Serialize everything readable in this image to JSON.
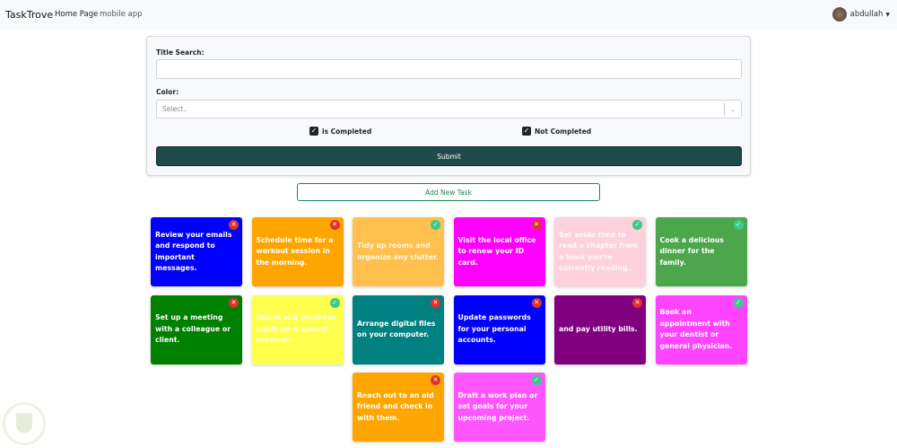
{
  "nav": {
    "brand": "TaskTrove",
    "links": [
      "Home Page",
      "mobile app"
    ],
    "user": "abdullah"
  },
  "form": {
    "title_label": "Title Search:",
    "title_value": "",
    "color_label": "Color:",
    "color_placeholder": "Select..",
    "completed_label": "is Completed",
    "completed_checked": true,
    "not_completed_label": "Not Completed",
    "not_completed_checked": true,
    "submit_label": "Submit"
  },
  "add_label": "Add New Task",
  "tasks": [
    {
      "text": "Review your emails and respond to important messages.",
      "color": "#0000ff",
      "completed": false
    },
    {
      "text": "Schedule time for a workout session in the morning.",
      "color": "#ffa500",
      "completed": false
    },
    {
      "text": "Tidy up rooms and organize any clutter.",
      "color": "#ffc04d",
      "completed": true
    },
    {
      "text": "Visit the local office to renew your ID card.",
      "color": "#ff00ff",
      "completed": false
    },
    {
      "text": "Set aside time to read a chapter from a book you're currently reading.",
      "color": "#ffd1dc",
      "completed": true
    },
    {
      "text": "Cook a delicious dinner for the family.",
      "color": "#4ca64c",
      "completed": true
    },
    {
      "text": "Set up a meeting with a colleague or client.",
      "color": "#008000",
      "completed": false
    },
    {
      "text": "Select and purchase a gift for a special occasion.",
      "color": "#ffff4d",
      "completed": true
    },
    {
      "text": "Arrange digital files on your computer.",
      "color": "#008080",
      "completed": false
    },
    {
      "text": "Update passwords for your personal accounts.",
      "color": "#0000ff",
      "completed": false
    },
    {
      "text": "and pay utility bills.",
      "color": "#800080",
      "completed": false
    },
    {
      "text": "Book an appointment with your dentist or general physician.",
      "color": "#ff44ff",
      "completed": true
    },
    {
      "text": "Reach out to an old friend and check in with them.",
      "color": "#ffa500",
      "completed": false
    },
    {
      "text": "Draft a work plan or set goals for your upcoming project.",
      "color": "#ff55ff",
      "completed": true
    }
  ]
}
